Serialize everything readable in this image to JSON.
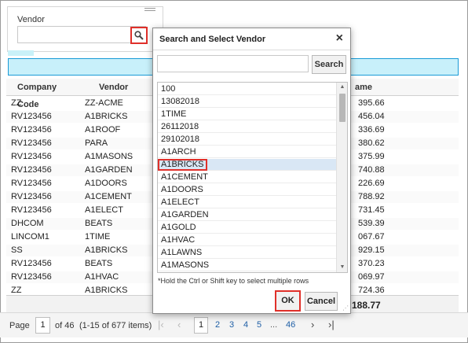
{
  "vendor_filter": {
    "label": "Vendor",
    "value": ""
  },
  "grid": {
    "columns": [
      "Company Code",
      "Vendor",
      "ame"
    ],
    "rows": [
      {
        "company": "ZZ",
        "vendor": "ZZ-ACME",
        "amount": "395.66"
      },
      {
        "company": "RV123456",
        "vendor": "A1BRICKS",
        "amount": "456.04"
      },
      {
        "company": "RV123456",
        "vendor": "A1ROOF",
        "amount": "336.69"
      },
      {
        "company": "RV123456",
        "vendor": "PARA",
        "amount": "380.62"
      },
      {
        "company": "RV123456",
        "vendor": "A1MASONS",
        "amount": "375.99"
      },
      {
        "company": "RV123456",
        "vendor": "A1GARDEN",
        "amount": "740.88"
      },
      {
        "company": "RV123456",
        "vendor": "A1DOORS",
        "amount": "226.69"
      },
      {
        "company": "RV123456",
        "vendor": "A1CEMENT",
        "amount": "788.92"
      },
      {
        "company": "RV123456",
        "vendor": "A1ELECT",
        "amount": "731.45"
      },
      {
        "company": "DHCOM",
        "vendor": "BEATS",
        "amount": "539.39"
      },
      {
        "company": "LINCOM1",
        "vendor": "1TIME",
        "amount": "067.67"
      },
      {
        "company": "SS",
        "vendor": "A1BRICKS",
        "amount": "929.15"
      },
      {
        "company": "RV123456",
        "vendor": "BEATS",
        "amount": "370.23"
      },
      {
        "company": "RV123456",
        "vendor": "A1HVAC",
        "amount": "069.97"
      },
      {
        "company": "ZZ",
        "vendor": "A1BRICKS",
        "amount": "724.36"
      }
    ],
    "total": "188.77"
  },
  "pager": {
    "page_label": "Page",
    "page_value": "1",
    "of_text": "of 46",
    "items_text": "(1-15 of 677 items)",
    "first_icon": "first-page-icon",
    "prev_icon": "prev-page-icon",
    "pages": [
      "1",
      "2",
      "3",
      "4",
      "5",
      "...",
      "46"
    ],
    "current_page": "1",
    "next_icon": "next-page-icon",
    "last_icon": "last-page-icon"
  },
  "dialog": {
    "title": "Search and Select Vendor",
    "close_icon": "close-icon",
    "search_value": "",
    "search_button": "Search",
    "items": [
      "100",
      "13082018",
      "1TIME",
      "26112018",
      "29102018",
      "A1ARCH",
      "A1BRICKS",
      "A1CEMENT",
      "A1DOORS",
      "A1ELECT",
      "A1GARDEN",
      "A1GOLD",
      "A1HVAC",
      "A1LAWNS",
      "A1MASONS"
    ],
    "selected_item": "A1BRICKS",
    "hint": "*Hold the Ctrl or Shift key to select multiple rows",
    "ok_button": "OK",
    "cancel_button": "Cancel"
  },
  "colors": {
    "highlight": "#e0302a",
    "filter_bar": "#c8f0fa",
    "filter_border": "#1a9bd7",
    "selection": "#d9e7f5",
    "link": "#1f5fa6"
  }
}
